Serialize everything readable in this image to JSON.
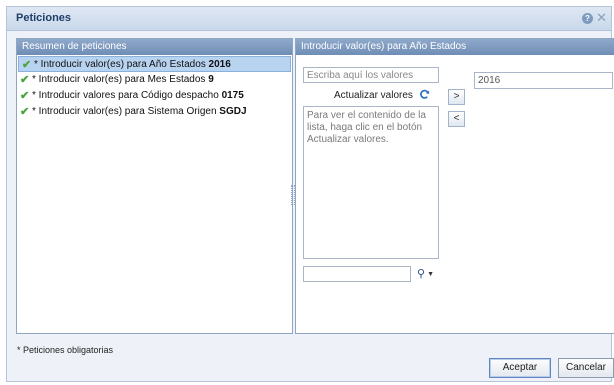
{
  "dialog": {
    "title": "Peticiones",
    "help_label": "?",
    "close_label": "✕"
  },
  "left_panel": {
    "header": "Resumen de peticiones",
    "items": [
      {
        "prefix": "* Introducir valor(es) para Año Estados ",
        "value": "2016",
        "selected": true
      },
      {
        "prefix": "* Introducir valor(es) para Mes Estados ",
        "value": "9",
        "selected": false
      },
      {
        "prefix": "* Introducir valores para Código despacho ",
        "value": "0175",
        "selected": false
      },
      {
        "prefix": "* Introducir valor(es) para Sistema Origen ",
        "value": "SGDJ",
        "selected": false
      }
    ]
  },
  "right_panel": {
    "header": "Introducir valor(es) para Año Estados",
    "values_placeholder": "Escriba aquí los valores",
    "refresh_label": "Actualizar valores",
    "list_hint": "Para ver el contenido de la lista, haga clic en el botón Actualizar valores.",
    "add_label": ">",
    "remove_label": "<",
    "selected_value": "2016",
    "search_value": ""
  },
  "footer": {
    "footnote": "* Peticiones obligatorias",
    "ok_label": "Aceptar",
    "cancel_label": "Cancelar"
  },
  "colors": {
    "accent": "#6f8db5",
    "check": "#4aa33b",
    "selection": "#b7d3f0"
  }
}
